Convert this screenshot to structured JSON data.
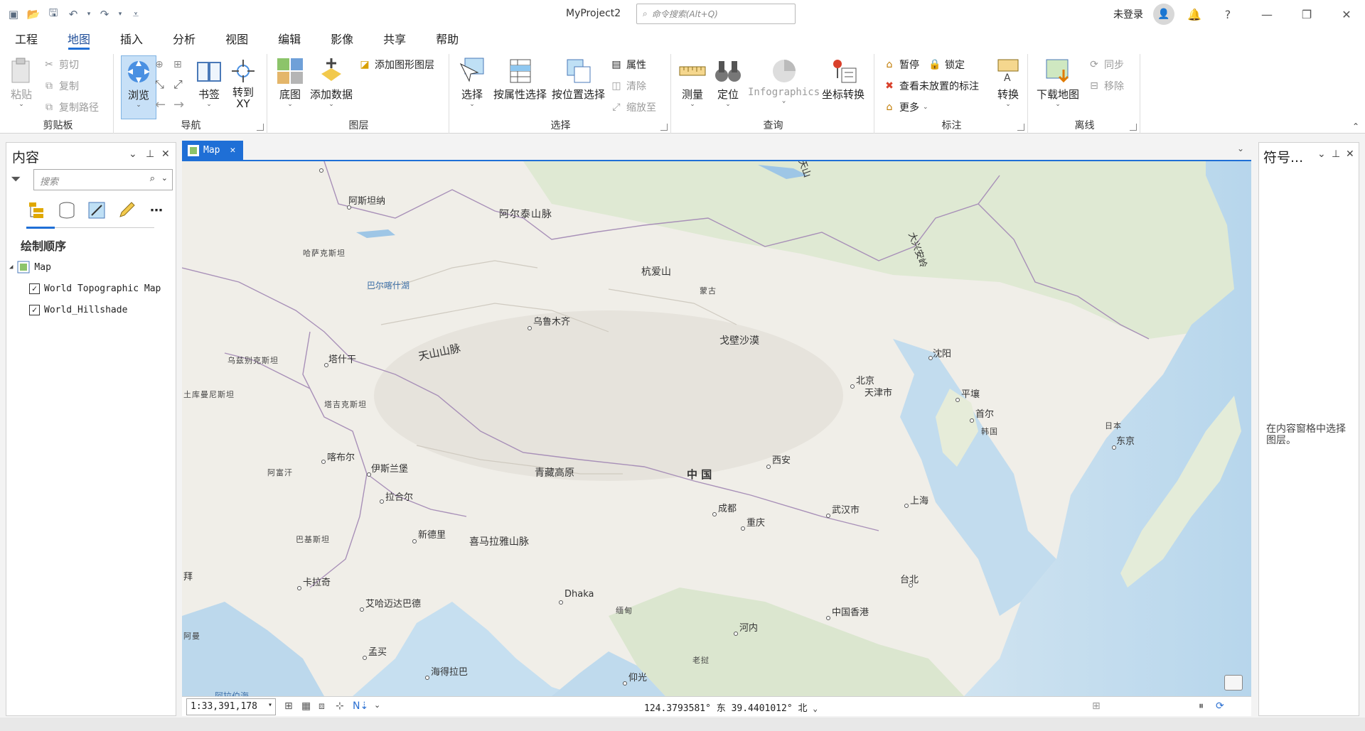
{
  "titlebar": {
    "app_title": "MyProject2",
    "search_placeholder": "命令搜索(Alt+Q)",
    "login": "未登录"
  },
  "menu": [
    "工程",
    "地图",
    "插入",
    "分析",
    "视图",
    "编辑",
    "影像",
    "共享",
    "帮助"
  ],
  "active_menu": "地图",
  "ribbon": {
    "clipboard": {
      "label": "剪贴板",
      "paste": "粘贴",
      "cut": "剪切",
      "copy": "复制",
      "copy_path": "复制路径"
    },
    "navigate": {
      "label": "导航",
      "explore": "浏览",
      "bookmarks": "书签",
      "goto_xy": "转到\nXY"
    },
    "layer": {
      "label": "图层",
      "basemap": "底图",
      "add_data": "添加数据",
      "add_graphics": "添加图形图层"
    },
    "selection": {
      "label": "选择",
      "select": "选择",
      "by_attr": "按属性选择",
      "by_loc": "按位置选择",
      "attributes": "属性",
      "clear": "清除",
      "zoom_to": "缩放至"
    },
    "inquiry": {
      "label": "查询",
      "measure": "测量",
      "locate": "定位",
      "infographics": "Infographics",
      "coord_conv": "坐标转换"
    },
    "labeling": {
      "label": "标注",
      "pause": "暂停",
      "lock": "锁定",
      "view_unplaced": "查看未放置的标注",
      "more": "更多",
      "convert": "转换"
    },
    "offline": {
      "label": "离线",
      "download": "下载地图",
      "sync": "同步",
      "remove": "移除"
    }
  },
  "contents": {
    "title": "内容",
    "search_placeholder": "搜索",
    "drawing_order": "绘制顺序",
    "map_name": "Map",
    "layers": [
      {
        "name": "World Topographic Map",
        "checked": true
      },
      {
        "name": "World_Hillshade",
        "checked": true
      }
    ]
  },
  "map_tab": {
    "label": "Map"
  },
  "map_labels": {
    "astana": "阿斯坦纳",
    "altai": "阿尔泰山脉",
    "kaz": "哈萨克斯坦",
    "balkhash": "巴尔喀什湖",
    "hangai": "杭爱山",
    "mongolia": "蒙古",
    "urumqi": "乌鲁木齐",
    "gobi": "戈壁沙漠",
    "greater_khingan": "大兴安岭",
    "shenyang": "沈阳",
    "tashkent": "塔什干",
    "uzbek": "乌兹别克斯坦",
    "tianshan": "天山山脉",
    "beijing": "北京",
    "tianjin": "天津市",
    "turkmen": "土库曼尼斯坦",
    "tajik": "塔吉克斯坦",
    "pyongyang": "平壤",
    "seoul": "首尔",
    "korea": "韩国",
    "japan": "日本",
    "tokyo": "东京",
    "kabul": "喀布尔",
    "islamabad": "伊斯兰堡",
    "afghan": "阿富汗",
    "tibet": "青藏高原",
    "china": "中 国",
    "xian": "西安",
    "lahore": "拉合尔",
    "chengdu": "成都",
    "wuhan": "武汉市",
    "shanghai": "上海",
    "chongqing": "重庆",
    "delhi": "新德里",
    "himalaya": "喜马拉雅山脉",
    "pakistan": "巴基斯坦",
    "karachi": "卡拉奇",
    "taipei": "台北",
    "ahmedabad": "艾哈迈达巴德",
    "dhaka": "Dhaka",
    "myanmar": "缅甸",
    "hongkong": "中国香港",
    "hanoi": "河内",
    "oman": "阿曼",
    "mumbai": "孟买",
    "hyderabad": "海得拉巴",
    "laos": "老挝",
    "yangon": "仰光",
    "iran": "拜",
    "tianshan2": "天山",
    "arabian": "阿拉伯海"
  },
  "status": {
    "scale": "1:33,391,178",
    "coords": "124.3793581° 东 39.4401012° 北"
  },
  "symbology": {
    "title": "符号...",
    "hint": "在内容窗格中选择图层。"
  }
}
